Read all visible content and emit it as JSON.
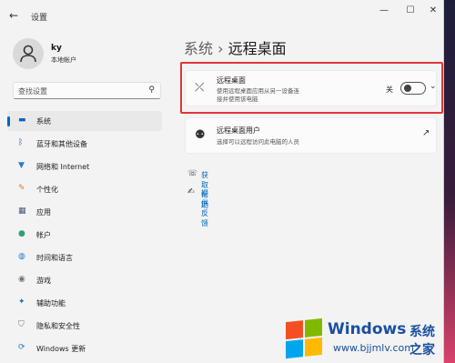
{
  "app_title": "设置",
  "window_controls": [
    "—",
    "☐",
    "✕"
  ],
  "user": {
    "name": "ky",
    "account": "本地帐户"
  },
  "search": {
    "placeholder": "查找设置"
  },
  "sidebar": {
    "items": [
      {
        "label": "系统",
        "icon": "monitor-icon",
        "glyph": "▬",
        "color": "#0067c0",
        "active": true
      },
      {
        "label": "蓝牙和其他设备",
        "icon": "bluetooth-icon",
        "glyph": "ᛒ",
        "color": "#0067c0"
      },
      {
        "label": "网络和 Internet",
        "icon": "wifi-icon",
        "glyph": "▼",
        "color": "#2a7bd5"
      },
      {
        "label": "个性化",
        "icon": "brush-icon",
        "glyph": "✎",
        "color": "#d4822a"
      },
      {
        "label": "应用",
        "icon": "apps-icon",
        "glyph": "▦",
        "color": "#4a5b7a"
      },
      {
        "label": "帐户",
        "icon": "account-icon",
        "glyph": "●",
        "color": "#2fa36b"
      },
      {
        "label": "时间和语言",
        "icon": "globe-clock-icon",
        "glyph": "◍",
        "color": "#1b7fd1"
      },
      {
        "label": "游戏",
        "icon": "gamepad-icon",
        "glyph": "◉",
        "color": "#6d7378"
      },
      {
        "label": "辅助功能",
        "icon": "accessibility-icon",
        "glyph": "✦",
        "color": "#1b6fc4"
      },
      {
        "label": "隐私和安全性",
        "icon": "shield-icon",
        "glyph": "⛉",
        "color": "#6d7378"
      },
      {
        "label": "Windows 更新",
        "icon": "update-icon",
        "glyph": "⟳",
        "color": "#1b7fd1"
      }
    ]
  },
  "breadcrumb": {
    "parent": "系统",
    "sep": "›",
    "current": "远程桌面"
  },
  "remote_desktop": {
    "title": "远程桌面",
    "desc1": "使用远程桌面应用从另一设备连",
    "desc2": "接并使用该电脑",
    "state": "关",
    "enabled": false
  },
  "remote_users": {
    "title": "远程桌面用户",
    "desc": "选择可以远程访问此电脑的人员"
  },
  "links": [
    {
      "label": "获取帮助",
      "icon": "help-icon"
    },
    {
      "label": "提供反馈",
      "icon": "feedback-icon"
    }
  ],
  "watermark": {
    "brand": "Windows",
    "cn": "系统之家",
    "url": "www.bjjmlv.com",
    "colors": [
      "#f25022",
      "#7fba00",
      "#00a4ef",
      "#ffb900"
    ]
  }
}
